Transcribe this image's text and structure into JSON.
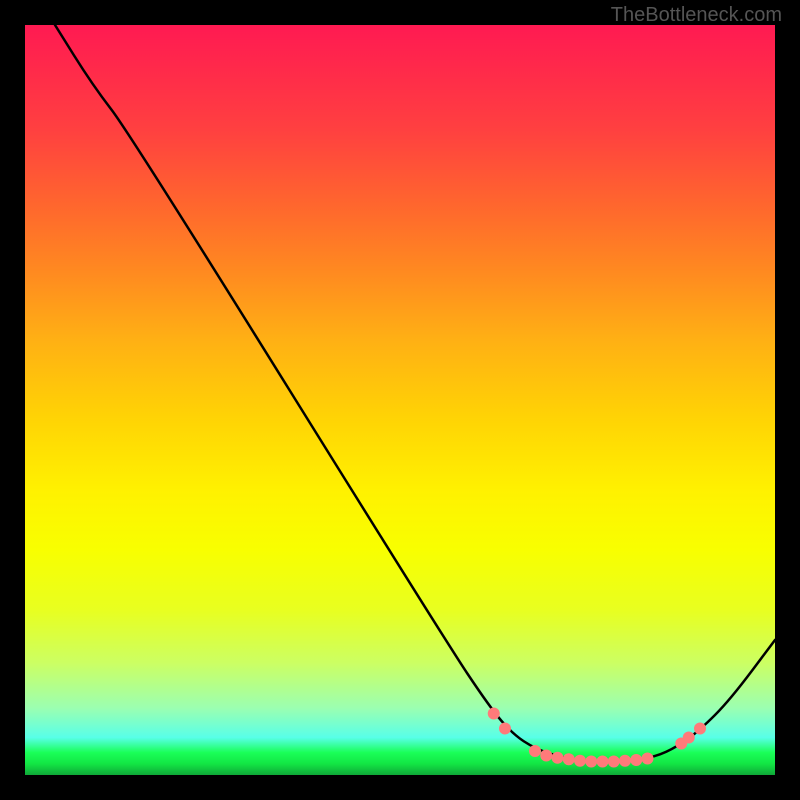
{
  "watermark": "TheBottleneck.com",
  "chart_data": {
    "type": "line",
    "title": "",
    "xlabel": "",
    "ylabel": "",
    "xlim": [
      0,
      100
    ],
    "ylim": [
      0,
      100
    ],
    "curve_points": [
      {
        "x": 4,
        "y": 100
      },
      {
        "x": 9,
        "y": 92
      },
      {
        "x": 14,
        "y": 85.5
      },
      {
        "x": 56,
        "y": 18
      },
      {
        "x": 62,
        "y": 9
      },
      {
        "x": 65,
        "y": 5.5
      },
      {
        "x": 68,
        "y": 3.5
      },
      {
        "x": 72,
        "y": 2.2
      },
      {
        "x": 76,
        "y": 1.8
      },
      {
        "x": 80,
        "y": 1.8
      },
      {
        "x": 84,
        "y": 2.4
      },
      {
        "x": 87,
        "y": 3.8
      },
      {
        "x": 90,
        "y": 6
      },
      {
        "x": 94,
        "y": 10
      },
      {
        "x": 100,
        "y": 18
      }
    ],
    "markers": [
      {
        "x": 62.5,
        "y": 8.2
      },
      {
        "x": 64,
        "y": 6.2
      },
      {
        "x": 68,
        "y": 3.2
      },
      {
        "x": 69.5,
        "y": 2.6
      },
      {
        "x": 71,
        "y": 2.3
      },
      {
        "x": 72.5,
        "y": 2.1
      },
      {
        "x": 74,
        "y": 1.9
      },
      {
        "x": 75.5,
        "y": 1.8
      },
      {
        "x": 77,
        "y": 1.8
      },
      {
        "x": 78.5,
        "y": 1.8
      },
      {
        "x": 80,
        "y": 1.9
      },
      {
        "x": 81.5,
        "y": 2.0
      },
      {
        "x": 83,
        "y": 2.2
      },
      {
        "x": 87.5,
        "y": 4.2
      },
      {
        "x": 88.5,
        "y": 5.0
      },
      {
        "x": 90,
        "y": 6.2
      }
    ],
    "marker_color": "#ff7a7a",
    "marker_radius": 6,
    "curve_color": "#000000",
    "curve_width": 2.5,
    "gradient_stops": [
      {
        "pos": 0,
        "color": "#ff1a52"
      },
      {
        "pos": 25,
        "color": "#ff6a2c"
      },
      {
        "pos": 52,
        "color": "#ffd205"
      },
      {
        "pos": 70,
        "color": "#f8ff00"
      },
      {
        "pos": 91,
        "color": "#9cffb0"
      },
      {
        "pos": 100,
        "color": "#0fa838"
      }
    ]
  }
}
